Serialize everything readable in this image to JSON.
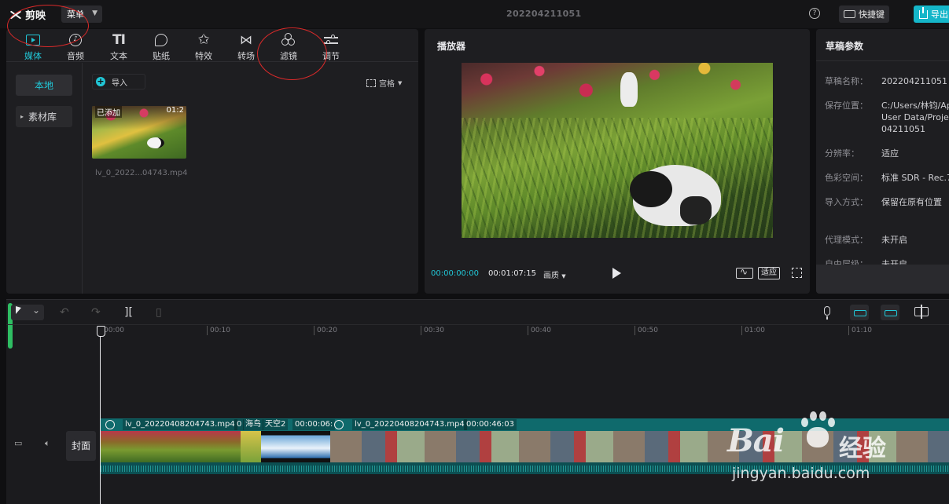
{
  "app": {
    "logo": "剪映",
    "menu_label": "菜单",
    "doc_title": "202204211051",
    "shortcut_label": "快捷键",
    "export_label": "导出",
    "accent": "#21c8d8"
  },
  "tabs": [
    {
      "label": "媒体",
      "icon": "media-icon",
      "active": true
    },
    {
      "label": "音频",
      "icon": "audio-icon"
    },
    {
      "label": "文本",
      "icon": "text-icon",
      "glyph": "TI"
    },
    {
      "label": "贴纸",
      "icon": "sticker-icon"
    },
    {
      "label": "特效",
      "icon": "effect-icon",
      "glyph": "✩"
    },
    {
      "label": "转场",
      "icon": "transition-icon",
      "glyph": "⋈"
    },
    {
      "label": "滤镜",
      "icon": "filter-icon"
    },
    {
      "label": "调节",
      "icon": "adjust-icon"
    }
  ],
  "media": {
    "nav": {
      "local": "本地",
      "library": "素材库"
    },
    "import_label": "导入",
    "view_label": "宫格",
    "thumb": {
      "added_badge": "已添加",
      "duration": "01:2",
      "filename": "lv_0_2022...04743.mp4"
    }
  },
  "player": {
    "title": "播放器",
    "time_current": "00:00:00:00",
    "time_total": "00:01:07:15",
    "quality_label": "画质",
    "fit_label": "适应"
  },
  "draft": {
    "title": "草稿参数",
    "params": [
      {
        "key": "草稿名称：",
        "value": "202204211051"
      },
      {
        "key": "保存位置：",
        "value": "C:/Users/林钧/Ap\nUser Data/Projec\n04211051"
      },
      {
        "key": "分辨率：",
        "value": "适应"
      },
      {
        "key": "色彩空间：",
        "value": "标准 SDR - Rec.7"
      },
      {
        "key": "导入方式：",
        "value": "保留在原有位置"
      },
      {
        "key": "代理模式：",
        "value": "未开启"
      },
      {
        "key": "自由层级：",
        "value": "未开启"
      }
    ]
  },
  "timeline": {
    "ruler": [
      "00:00",
      "00:10",
      "00:20",
      "00:30",
      "00:40",
      "00:50",
      "01:00",
      "01:10"
    ],
    "cover_label": "封面",
    "clips": [
      {
        "name": "lv_0_20220408204743.mp4",
        "duration": "0"
      },
      {
        "name": "海鸟",
        "duration": ""
      },
      {
        "name": "天空2",
        "duration": "00:00:06:"
      },
      {
        "name": "lv_0_20220408204743.mp4",
        "duration": "00:00:46:03"
      }
    ]
  },
  "watermark": {
    "brand": "Bai",
    "cn": "经验",
    "url": "jingyan.baidu.com"
  }
}
